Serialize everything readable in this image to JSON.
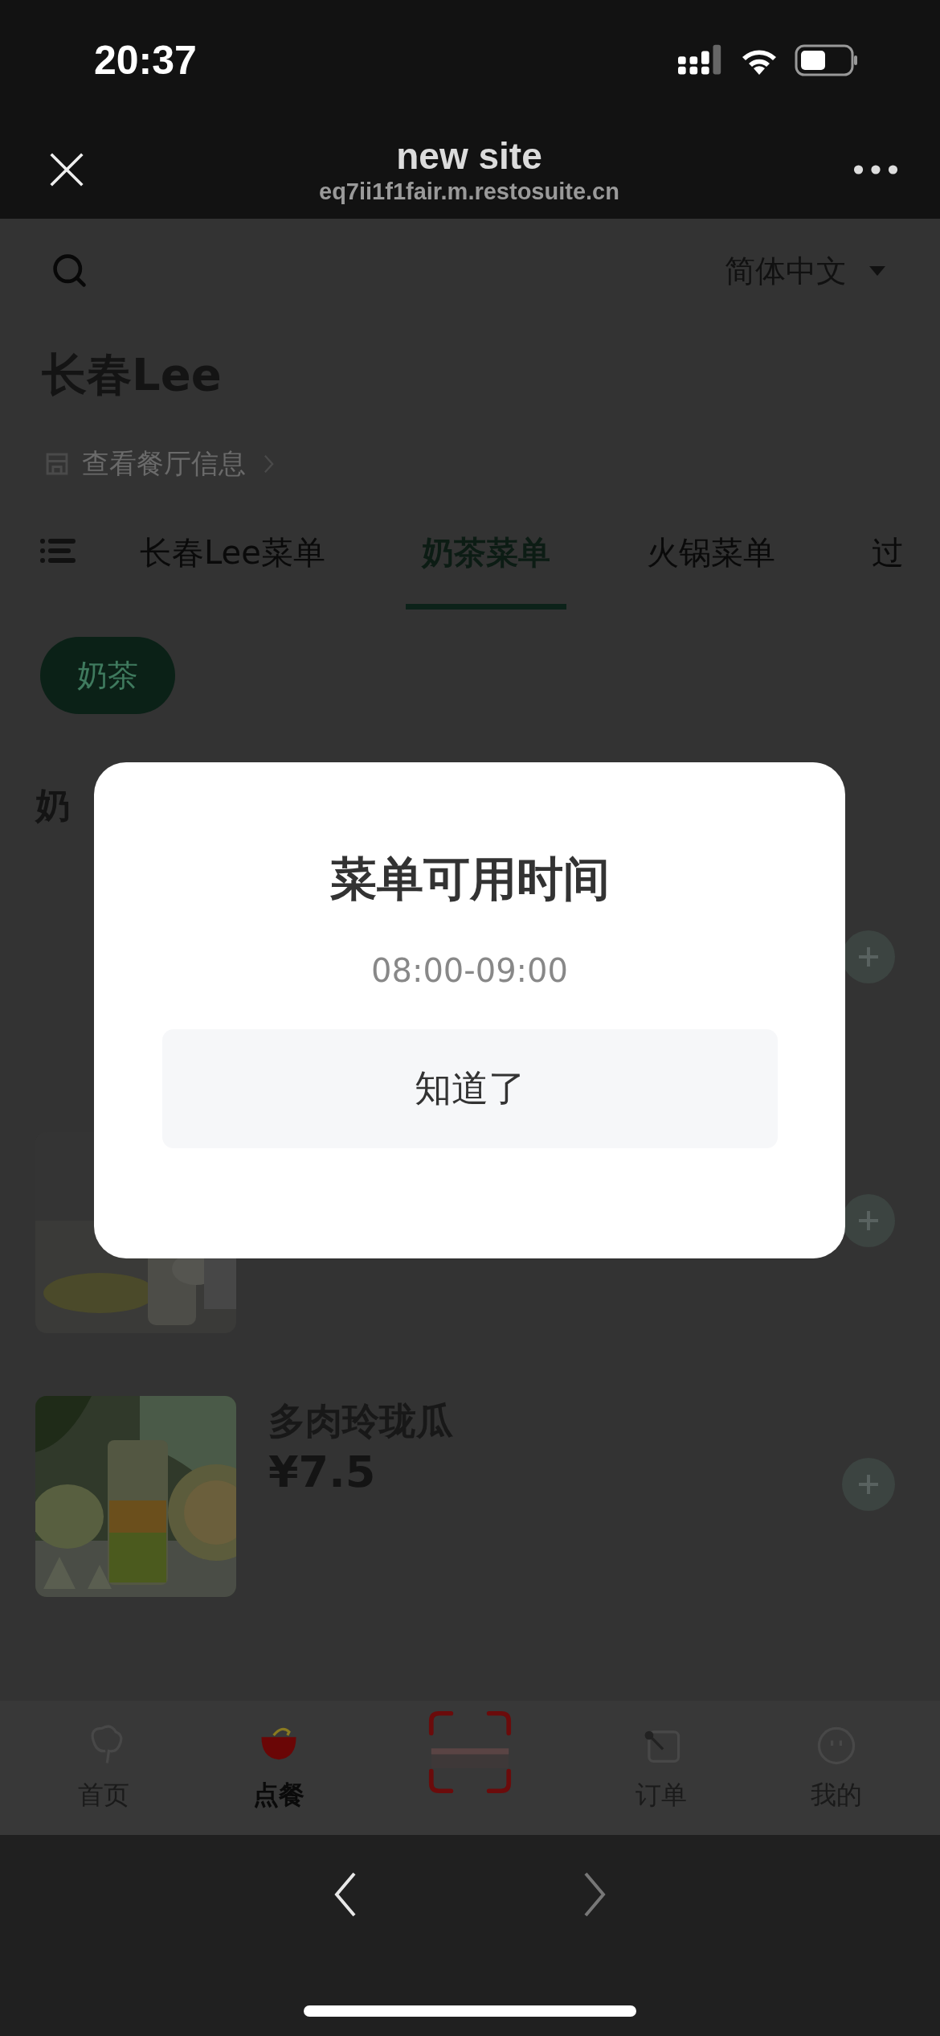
{
  "status_bar": {
    "time": "20:37"
  },
  "browser_header": {
    "title": "new site",
    "url": "eq7ii1f1fair.m.restosuite.cn"
  },
  "language": "简体中文",
  "restaurant": {
    "name": "长春Lee",
    "info_link": "查看餐厅信息"
  },
  "menu_tabs": [
    {
      "label": "长春Lee菜单",
      "selected": false
    },
    {
      "label": "奶茶菜单",
      "selected": true
    },
    {
      "label": "火锅菜单",
      "selected": false
    },
    {
      "label": "过",
      "selected": false
    }
  ],
  "categories": [
    {
      "label": "奶茶",
      "selected": true
    }
  ],
  "section_title": "奶",
  "items": [
    {
      "picture": false
    },
    {
      "picture": true
    },
    {
      "picture": true,
      "name": "多肉玲珑瓜",
      "price": "¥7.5"
    }
  ],
  "dialog": {
    "title": "菜单可用时间",
    "time": "08:00-09:00",
    "button": "知道了"
  },
  "bottom_nav": [
    {
      "kind": "home",
      "label": "首页",
      "selected": false
    },
    {
      "kind": "order",
      "label": "点餐",
      "selected": true
    },
    {
      "kind": "scan"
    },
    {
      "kind": "orders",
      "label": "订单",
      "selected": false
    },
    {
      "kind": "profile",
      "label": "我的",
      "selected": false
    }
  ],
  "browser_nav": {
    "back_disabled": false,
    "forward_disabled": true
  }
}
